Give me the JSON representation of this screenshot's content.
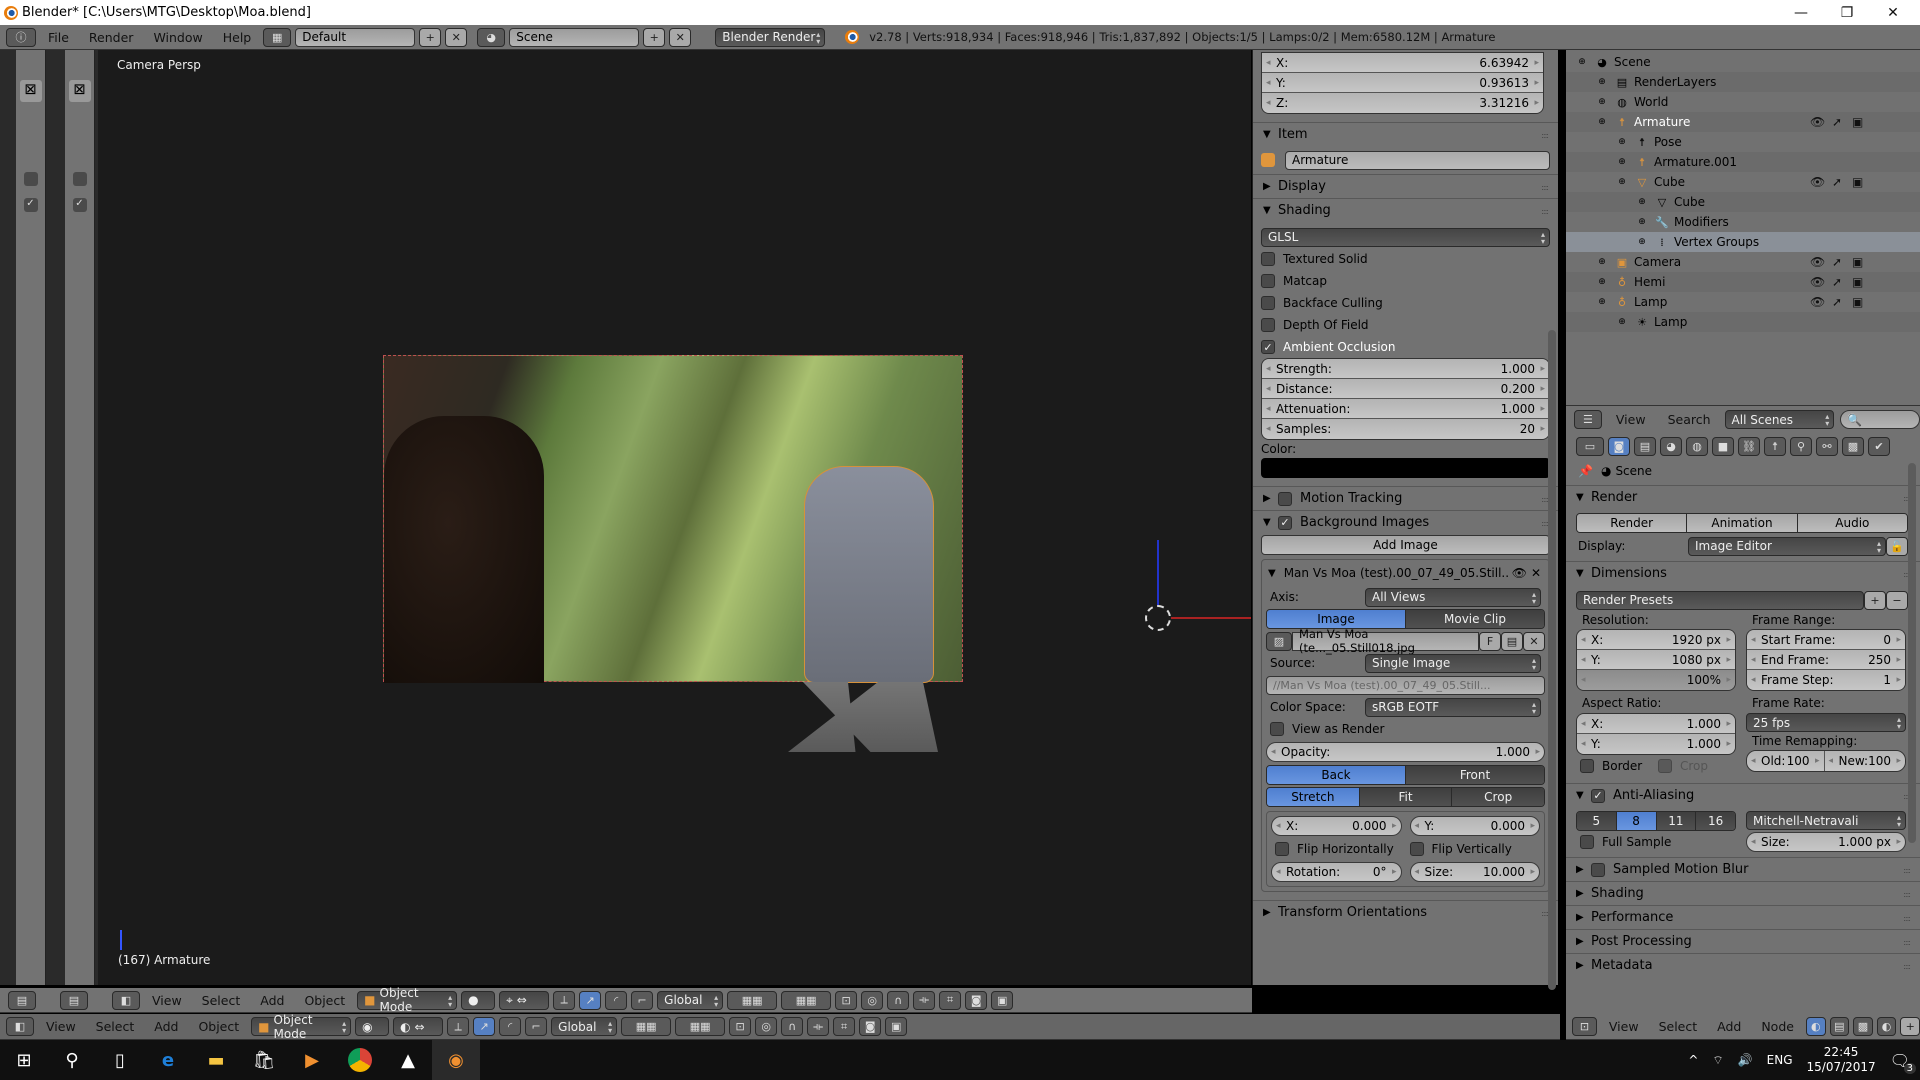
{
  "window": {
    "title": "Blender* [C:\\Users\\MTG\\Desktop\\Moa.blend]",
    "controls": [
      "minimize-icon",
      "restore-icon",
      "close-icon"
    ]
  },
  "info_header": {
    "menus": [
      "File",
      "Render",
      "Window",
      "Help"
    ],
    "layout": "Default",
    "scene": "Scene",
    "engine": "Blender Render",
    "stats": "v2.78 | Verts:918,934 | Faces:918,946 | Tris:1,837,892 | Objects:1/5 | Lamps:0/2 | Mem:6580.12M | Armature"
  },
  "viewport": {
    "view_name": "Camera Persp",
    "frame_object": "(167) Armature"
  },
  "npanel": {
    "location": {
      "x_label": "X:",
      "x": "6.63942",
      "y_label": "Y:",
      "y": "0.93613",
      "z_label": "Z:",
      "z": "3.31216"
    },
    "item": {
      "title": "Item",
      "name": "Armature"
    },
    "display": {
      "title": "Display"
    },
    "shading": {
      "title": "Shading",
      "mode": "GLSL",
      "options": [
        {
          "label": "Textured Solid",
          "checked": false
        },
        {
          "label": "Matcap",
          "checked": false
        },
        {
          "label": "Backface Culling",
          "checked": false
        },
        {
          "label": "Depth Of Field",
          "checked": false
        },
        {
          "label": "Ambient Occlusion",
          "checked": true
        }
      ],
      "ao": [
        {
          "label": "Strength:",
          "value": "1.000"
        },
        {
          "label": "Distance:",
          "value": "0.200"
        },
        {
          "label": "Attenuation:",
          "value": "1.000"
        },
        {
          "label": "Samples:",
          "value": "20"
        }
      ],
      "color_label": "Color:",
      "color": "#000000"
    },
    "motion_tracking": {
      "title": "Motion Tracking",
      "checked": false
    },
    "background_images": {
      "title": "Background Images",
      "checked": true,
      "add_label": "Add Image",
      "entry_name": "Man Vs Moa (test).00_07_49_05.Still...",
      "axis_label": "Axis:",
      "axis": "All Views",
      "source_tabs": [
        "Image",
        "Movie Clip"
      ],
      "image_file": "Man Vs Moa (te..._05.Still018.jpg",
      "fake_user": "F",
      "source_label": "Source:",
      "source": "Single Image",
      "filepath": "//Man Vs Moa (test).00_07_49_05.Still...",
      "colorspace_label": "Color Space:",
      "colorspace": "sRGB EOTF",
      "view_as_render": "View as Render",
      "opacity_label": "Opacity:",
      "opacity": "1.000",
      "depth": [
        "Back",
        "Front"
      ],
      "frame": [
        "Stretch",
        "Fit",
        "Crop"
      ],
      "offset_x_label": "X:",
      "offset_x": "0.000",
      "offset_y_label": "Y:",
      "offset_y": "0.000",
      "flip_h": "Flip Horizontally",
      "flip_v": "Flip Vertically",
      "rotation_label": "Rotation:",
      "rotation": "0°",
      "size_label": "Size:",
      "size": "10.000"
    },
    "transform_orientations": {
      "title": "Transform Orientations"
    }
  },
  "view3d_header": {
    "menus": [
      "View",
      "Select",
      "Add",
      "Object"
    ],
    "mode": "Object Mode",
    "orientation": "Global"
  },
  "outliner": {
    "tree": [
      {
        "label": "Scene",
        "depth": 0,
        "icon": "scene-icon"
      },
      {
        "label": "RenderLayers",
        "depth": 1,
        "icon": "render-layers-icon"
      },
      {
        "label": "World",
        "depth": 1,
        "icon": "world-icon"
      },
      {
        "label": "Armature",
        "depth": 1,
        "icon": "armature-icon",
        "vis": true
      },
      {
        "label": "Pose",
        "depth": 2,
        "icon": "pose-icon"
      },
      {
        "label": "Armature.001",
        "depth": 2,
        "icon": "armature-data-icon"
      },
      {
        "label": "Cube",
        "depth": 2,
        "icon": "mesh-icon",
        "vis": true
      },
      {
        "label": "Cube",
        "depth": 3,
        "icon": "mesh-data-icon"
      },
      {
        "label": "Modifiers",
        "depth": 3,
        "icon": "wrench-icon"
      },
      {
        "label": "Vertex Groups",
        "depth": 3,
        "icon": "vertex-groups-icon"
      },
      {
        "label": "Camera",
        "depth": 1,
        "icon": "camera-icon",
        "vis": true
      },
      {
        "label": "Hemi",
        "depth": 1,
        "icon": "lamp-icon",
        "vis": true
      },
      {
        "label": "Lamp",
        "depth": 1,
        "icon": "lamp-icon",
        "vis": true
      },
      {
        "label": "Lamp",
        "depth": 2,
        "icon": "sun-icon"
      }
    ],
    "header": {
      "view": "View",
      "search": "Search",
      "filter": "All Scenes"
    }
  },
  "properties": {
    "context": "Scene",
    "render": {
      "title": "Render",
      "buttons": [
        "Render",
        "Animation",
        "Audio"
      ],
      "display_label": "Display:",
      "display": "Image Editor"
    },
    "dimensions": {
      "title": "Dimensions",
      "presets": "Render Presets",
      "resolution_label": "Resolution:",
      "res_x": "1920 px",
      "res_y": "1080 px",
      "res_pct": "100%",
      "frame_range_label": "Frame Range:",
      "start_frame": "0",
      "end_frame": "250",
      "frame_step": "1",
      "aspect_label": "Aspect Ratio:",
      "aspect_x": "1.000",
      "aspect_y": "1.000",
      "frame_rate_label": "Frame Rate:",
      "frame_rate": "25 fps",
      "time_remap_label": "Time Remapping:",
      "old": "100",
      "new": "100",
      "border": "Border",
      "crop": "Crop"
    },
    "anti_aliasing": {
      "title": "Anti-Aliasing",
      "checked": true,
      "samples": [
        "5",
        "8",
        "11",
        "16"
      ],
      "selected": "8",
      "filter": "Mitchell-Netravali",
      "full_sample": "Full Sample",
      "size_label": "Size:",
      "size": "1.000 px"
    },
    "collapsed": [
      "Sampled Motion Blur",
      "Shading",
      "Performance",
      "Post Processing",
      "Metadata"
    ]
  },
  "node_header": {
    "menus": [
      "View",
      "Select",
      "Add",
      "Node"
    ]
  },
  "taskbar": {
    "time": "22:45",
    "date": "15/07/2017",
    "lang": "ENG",
    "notifications": "3"
  }
}
